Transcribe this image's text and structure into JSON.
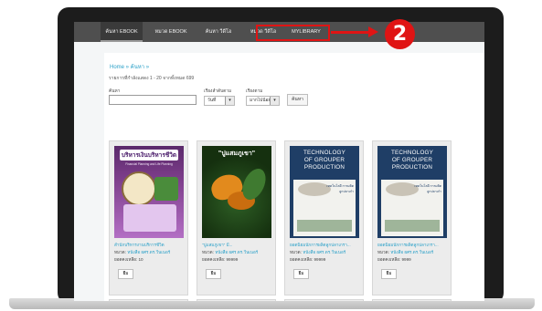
{
  "navbar": {
    "items": [
      {
        "label": "ค้นหา EBOOK"
      },
      {
        "label": "หมวด EBOOK"
      },
      {
        "label": "ค้นหา วีดีโอ"
      },
      {
        "label": "หมวด วีดีโอ"
      },
      {
        "label": "MYLIBRARY"
      }
    ]
  },
  "annotation": {
    "step_number": "2",
    "color": "#e01414"
  },
  "breadcrumb": {
    "text": "Home » ค้นหา »"
  },
  "results": {
    "range_text": "รายการที่กำลังแสดง 1 - 20 จากทั้งหมด 699"
  },
  "search": {
    "label": "ค้นหา",
    "value": "",
    "sort_label": "เรียงลำดับตาม",
    "sort_value": "วันที่",
    "order_label": "เรียงตาม",
    "order_value": "มากไปน้อย",
    "button": "ค้นหา"
  },
  "books": [
    {
      "title": "สำนักบริหารงานบริการชีวิต",
      "cover_text": "บริหารเงินบริหารชีวิต",
      "cover_subtext": "Financial Planning and Life Planning",
      "category_label": "หมวด:",
      "category_value": "หนังสือ ผศร.ดร.วีนเนอร์",
      "count_label": "ยอดคงเหลือ:",
      "count_value": "10",
      "button": "ยืม"
    },
    {
      "title": "\"ปูแสมภูเขา\" มี...",
      "cover_text": "\"ปูแสมภูเขา\"",
      "category_label": "หมวด:",
      "category_value": "หนังสือ ผศร.ดร.วีนเนอร์",
      "count_label": "ยอดคงเหลือ:",
      "count_value": "99999",
      "button": "ยืม"
    },
    {
      "title": "ยอดนิยมนักการผลิตลูกปลาเกรา...",
      "cover_heading": [
        "TECHNOLOGY",
        "OF GROUPER",
        "PRODUCTION"
      ],
      "cover_subtext": "เทคโนโลยี การผลิตลูกปลาเก๋า",
      "category_label": "หมวด:",
      "category_value": "หนังสือ ผศร.ดร.วีนเนอร์",
      "count_label": "ยอดคงเหลือ:",
      "count_value": "99999",
      "button": "ยืม"
    },
    {
      "title": "ยอดนิยมนักการผลิตลูกปลาเกรา...",
      "cover_heading": [
        "TECHNOLOGY",
        "OF GROUPER",
        "PRODUCTION"
      ],
      "cover_subtext": "เทคโนโลยี การผลิตลูกปลาเก๋า",
      "category_label": "หมวด:",
      "category_value": "หนังสือ ผศร.ดร.วีนเนอร์",
      "count_label": "ยอดคงเหลือ:",
      "count_value": "9999",
      "button": "ยืม"
    }
  ]
}
